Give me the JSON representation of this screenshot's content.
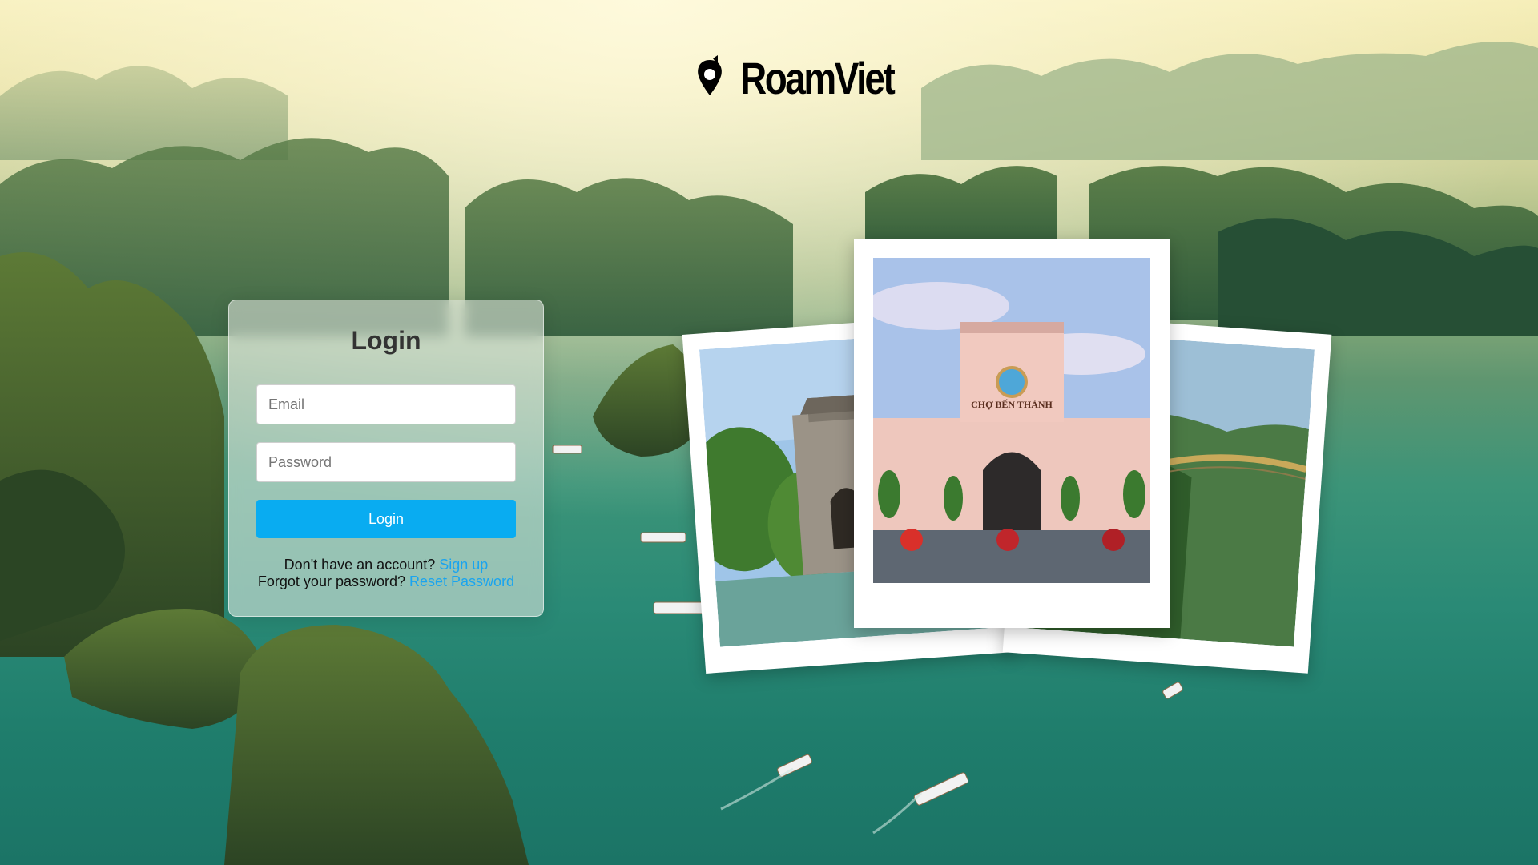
{
  "brand": {
    "name": "RoamViet",
    "icon": "map-pin-icon"
  },
  "login": {
    "title": "Login",
    "email_placeholder": "Email",
    "password_placeholder": "Password",
    "submit_label": "Login",
    "signup_prompt": "Don't have an account?",
    "signup_link": "Sign up",
    "reset_prompt": "Forgot your password?",
    "reset_link": "Reset Password"
  },
  "gallery": {
    "center_sign": "CHỢ BẾN THÀNH"
  },
  "colors": {
    "accent": "#09acf1",
    "link": "#1aa4ef",
    "water": "#2a8a76",
    "sky": "#f6eeb8"
  }
}
